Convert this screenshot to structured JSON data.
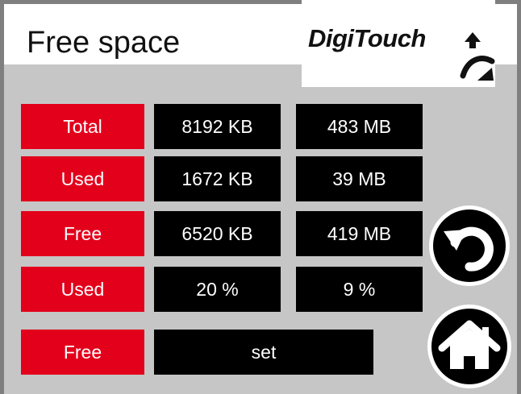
{
  "header": {
    "title": "Free space",
    "logo_text": "DigiTouch"
  },
  "rows": [
    {
      "label": "Total",
      "col1": "8192 KB",
      "col2": "483 MB"
    },
    {
      "label": "Used",
      "col1": "1672 KB",
      "col2": "39 MB"
    },
    {
      "label": "Free",
      "col1": "6520 KB",
      "col2": "419 MB"
    },
    {
      "label": "Used",
      "col1": "20 %",
      "col2": "9 %"
    }
  ],
  "bottom_row": {
    "label": "Free",
    "set_label": "set"
  },
  "buttons": {
    "back": {
      "icon": "undo-arrow-icon"
    },
    "home": {
      "icon": "home-icon"
    }
  },
  "colors": {
    "label_bg": "#e3001b",
    "value_bg": "#000000",
    "panel_bg": "#c6c6c6",
    "frame": "#7f7f7f"
  }
}
